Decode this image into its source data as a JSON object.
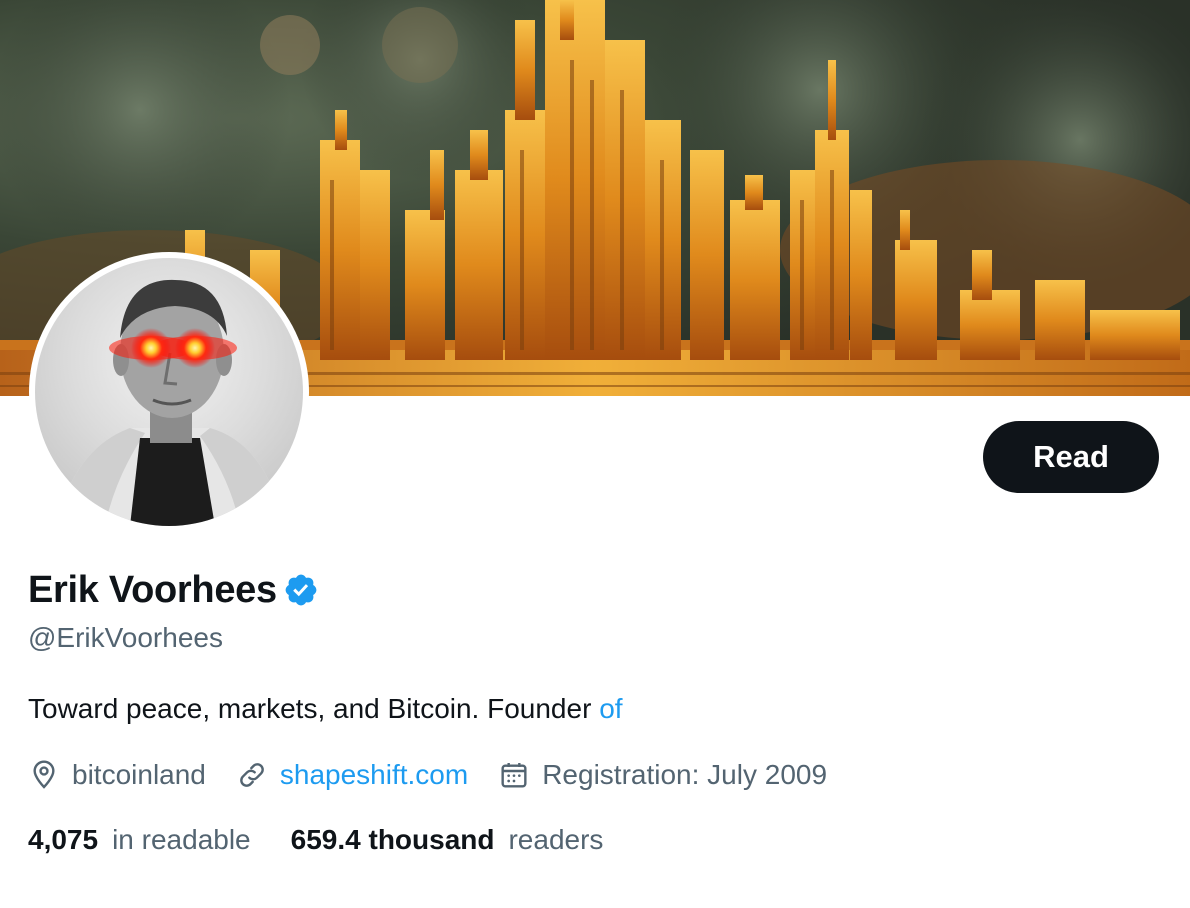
{
  "profile": {
    "name": "Erik Voorhees",
    "handle": "@ErikVoorhees",
    "bio_text": "Toward peace, markets, and Bitcoin. Founder ",
    "bio_link": "of",
    "location": "bitcoinland",
    "website": "shapeshift.com",
    "registration": "Registration: July 2009",
    "verified": true
  },
  "actions": {
    "read_label": "Read"
  },
  "stats": {
    "following_count": "4,075",
    "following_label": "in readable",
    "followers_count": "659.4 thousand",
    "followers_label": "readers"
  },
  "icons": {
    "verified": "verified-badge-icon",
    "location": "location-pin-icon",
    "link": "link-icon",
    "calendar": "calendar-icon"
  },
  "colors": {
    "accent": "#1d9bf0",
    "text_primary": "#0f1419",
    "text_secondary": "#536471",
    "button_bg": "#0f1419"
  }
}
